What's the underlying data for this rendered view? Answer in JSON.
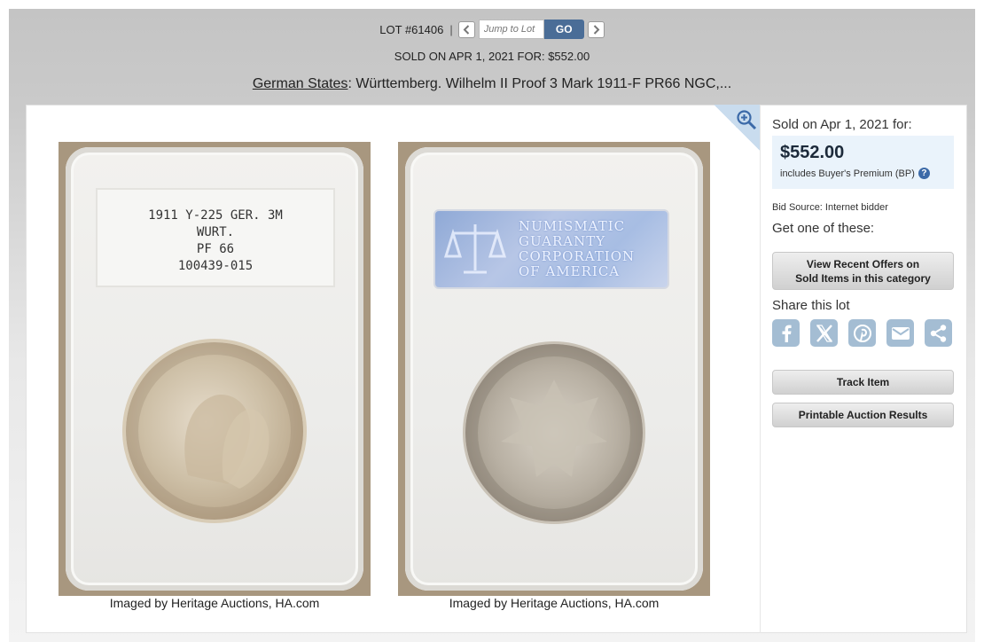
{
  "nav": {
    "lot_label": "LOT #61406",
    "separator": "|",
    "jump_placeholder": "Jump to Lot",
    "go_label": "GO"
  },
  "sold_line": "SOLD ON APR 1, 2021 FOR: $552.00",
  "title": {
    "category_link": "German States",
    "rest": ": Württemberg. Wilhelm II Proof 3 Mark 1911-F PR66 NGC,..."
  },
  "images": {
    "left": {
      "label_lines": [
        "1911 Y-225 GER. 3M",
        "WURT.",
        "PF 66",
        "100439-015"
      ],
      "caption": "Imaged by Heritage Auctions, HA.com"
    },
    "right": {
      "hologram_lines": [
        "NUMISMATIC",
        "GUARANTY",
        "CORPORATION",
        "OF AMERICA"
      ],
      "caption": "Imaged by Heritage Auctions, HA.com"
    }
  },
  "sidebar": {
    "sold_on": "Sold on Apr 1, 2021 for:",
    "price": "$552.00",
    "bp_note": "includes Buyer's Premium (BP)",
    "help_glyph": "?",
    "bid_source": "Bid Source: Internet bidder",
    "get_one": "Get one of these:",
    "offers_line1": "View Recent Offers on",
    "offers_line2": "Sold Items in this category",
    "share_title": "Share this lot",
    "share_icons": [
      "facebook-icon",
      "x-icon",
      "pinterest-icon",
      "email-icon",
      "share-icon"
    ],
    "track_label": "Track Item",
    "print_label": "Printable Auction Results"
  },
  "colors": {
    "accent": "#4a6d97",
    "price_box": "#eaf3fb",
    "share_icon": "#a4bdd3"
  }
}
